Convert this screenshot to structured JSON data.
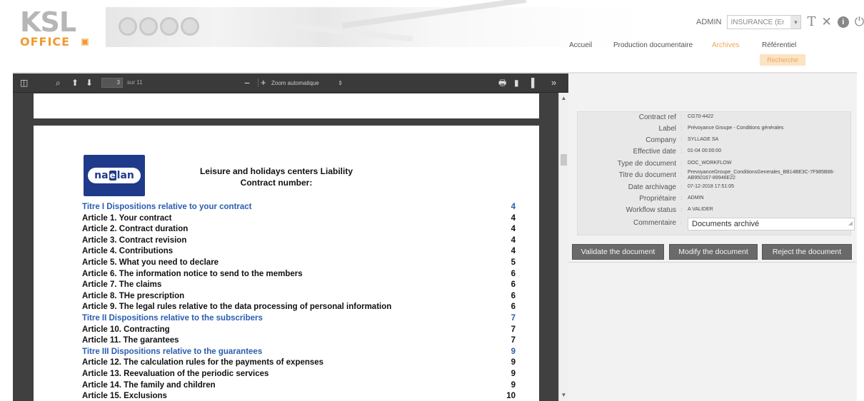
{
  "brand": {
    "logo_main": "KSL",
    "logo_sub": "OFFICE"
  },
  "header": {
    "user": "ADMIN",
    "context_select": "INSURANCE (Er",
    "icons": [
      "text-size-icon",
      "tools-icon",
      "info-icon",
      "power-icon"
    ]
  },
  "nav": {
    "items": [
      {
        "label": "Accueil"
      },
      {
        "label": "Production documentaire"
      },
      {
        "label": "Archives",
        "active": true
      },
      {
        "label": "Référentiel"
      }
    ],
    "sub_item": "Recherche"
  },
  "viewer": {
    "page_current": "3",
    "page_of": "sur 11",
    "zoom": "Zoom automatique",
    "minus": "−",
    "plus": "+"
  },
  "document": {
    "logo_text": "naelan",
    "title_line1": "Leisure and holidays centers Liability",
    "title_line2": "Contract number:",
    "toc": [
      {
        "text": "Titre I   Dispositions relative to your contract",
        "page": "4",
        "titre": true
      },
      {
        "text": "Article 1. Your contract",
        "page": "4"
      },
      {
        "text": "Article 2. Contract duration",
        "page": "4"
      },
      {
        "text": "Article 3. Contract revision",
        "page": "4"
      },
      {
        "text": "Article 4. Contributions",
        "page": "4"
      },
      {
        "text": "Article 5. What you need to declare",
        "page": "5"
      },
      {
        "text": "Article 6. The information notice to send to the members",
        "page": "6"
      },
      {
        "text": "Article 7. The claims",
        "page": "6"
      },
      {
        "text": "Article 8. THe prescription",
        "page": "6"
      },
      {
        "text": "Article 9. The legal rules relative to the data processing of personal information",
        "page": "6"
      },
      {
        "text": "Titre II   Dispositions relative to the subscribers",
        "page": "7",
        "titre": true
      },
      {
        "text": "Article 10. Contracting",
        "page": "7"
      },
      {
        "text": "Article 11. The garantees",
        "page": "7"
      },
      {
        "text": "Titre III   Dispositions relative to the guarantees",
        "page": "9",
        "titre": true
      },
      {
        "text": "Article 12. The calculation rules for the payments of expenses",
        "page": "9"
      },
      {
        "text": "Article 13. Reevaluation of the periodic services",
        "page": "9"
      },
      {
        "text": "Article 14. The family and children",
        "page": "9"
      },
      {
        "text": "Article 15. Exclusions",
        "page": "10"
      }
    ]
  },
  "details": {
    "rows": [
      {
        "label": "Contract ref",
        "value": "CG70-4422"
      },
      {
        "label": "Label",
        "value": "Prévoyance Groupe - Conditions générales"
      },
      {
        "label": "Company",
        "value": "SYLLAGE SA"
      },
      {
        "label": "Effective date",
        "value": "01-04 00:00:00"
      },
      {
        "label": "Type de document",
        "value": "DOC_WORKFLOW"
      },
      {
        "label": "Titre du document",
        "value": "PrevoyanceGroupe_ConditionsGenerales_BB14BE3C-7F985B86-AB950167-89946E22"
      },
      {
        "label": "Date archivage",
        "value": "07-12-2018 17:51:05"
      },
      {
        "label": "Propriétaire",
        "value": "ADMIN"
      },
      {
        "label": "Workflow status",
        "value": "A VALIDER"
      },
      {
        "label": "Commentaire",
        "value": "Documents archivé"
      }
    ]
  },
  "actions": {
    "validate": "Validate the document",
    "modify": "Modify the document",
    "reject": "Reject the document"
  }
}
